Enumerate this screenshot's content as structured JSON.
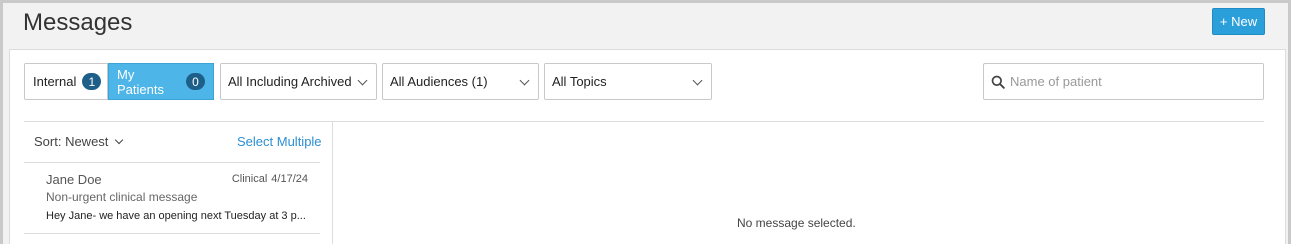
{
  "header": {
    "title": "Messages",
    "new_button": "+ New"
  },
  "filters": {
    "toggle": [
      {
        "label": "Internal",
        "count": "1",
        "active": false
      },
      {
        "label": "My Patients",
        "count": "0",
        "active": true
      }
    ],
    "archive_select": "All Including Archived",
    "audience_select": "All Audiences (1)",
    "topic_select": "All Topics",
    "search": {
      "placeholder": "Name of patient",
      "value": ""
    }
  },
  "list": {
    "sort_label": "Sort: Newest",
    "select_multiple": "Select Multiple",
    "items": [
      {
        "name": "Jane Doe",
        "tag": "Clinical",
        "date": "4/17/24",
        "subject": "Non-urgent clinical message",
        "preview": "Hey Jane- we have an opening next Tuesday at 3 p..."
      }
    ]
  },
  "detail": {
    "empty_text": "No message selected."
  },
  "colors": {
    "accent": "#4db5e8",
    "button": "#2b9fd9",
    "badge": "#1e5f8a",
    "link": "#2b8fd0"
  }
}
